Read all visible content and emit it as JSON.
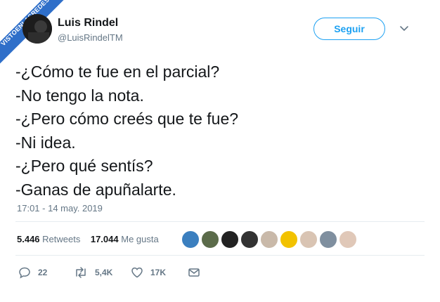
{
  "watermark": {
    "text": "VISTOENLASREDES",
    "suffix": ".com"
  },
  "user": {
    "name": "Luis Rindel",
    "handle": "@LuisRindelTM"
  },
  "follow_button": {
    "label": "Seguir"
  },
  "tweet": {
    "lines": [
      "-¿Cómo te fue en el parcial?",
      "-No tengo la nota.",
      "-¿Pero cómo creés que te fue?",
      "-Ni idea.",
      "-¿Pero qué sentís?",
      "-Ganas de apuñalarte."
    ],
    "timestamp": "17:01 - 14 may. 2019"
  },
  "stats": {
    "retweets_count": "5.446",
    "retweets_label": "Retweets",
    "likes_count": "17.044",
    "likes_label": "Me gusta"
  },
  "liker_avatars": [
    {
      "color": "#3b7fbf"
    },
    {
      "color": "#5b6b4a"
    },
    {
      "color": "#222222"
    },
    {
      "color": "#333333"
    },
    {
      "color": "#c9b9a9"
    },
    {
      "color": "#f2c200"
    },
    {
      "color": "#d9c4b3"
    },
    {
      "color": "#7f8f9f"
    },
    {
      "color": "#e0c8b8"
    }
  ],
  "actions": {
    "replies": "22",
    "retweets": "5,4K",
    "likes": "17K"
  },
  "colors": {
    "accent": "#1da1f2",
    "muted": "#657786",
    "text": "#14171a",
    "divider": "#e6ecf0"
  }
}
